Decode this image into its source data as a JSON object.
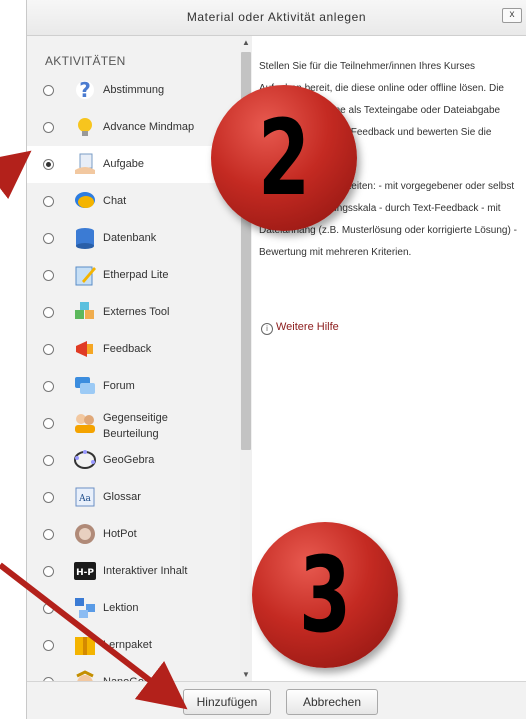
{
  "dialog": {
    "title": "Material oder Aktivität anlegen",
    "close_label": "x"
  },
  "left": {
    "section_label": "AKTIVITÄTEN",
    "selected": "Aufgabe",
    "items": [
      {
        "label": "Abstimmung",
        "icon": "question-icon"
      },
      {
        "label": "Advance Mindmap",
        "icon": "lightbulb-icon"
      },
      {
        "label": "Aufgabe",
        "icon": "hand-document-icon"
      },
      {
        "label": "Chat",
        "icon": "chat-bubble-icon"
      },
      {
        "label": "Datenbank",
        "icon": "database-icon"
      },
      {
        "label": "Etherpad Lite",
        "icon": "pen-notepad-icon"
      },
      {
        "label": "Externes Tool",
        "icon": "puzzle-icon"
      },
      {
        "label": "Feedback",
        "icon": "megaphone-icon"
      },
      {
        "label": "Forum",
        "icon": "forum-icon"
      },
      {
        "label": "Gegenseitige Beurteilung",
        "icon": "people-icon"
      },
      {
        "label": "GeoGebra",
        "icon": "geogebra-icon"
      },
      {
        "label": "Glossar",
        "icon": "glossary-icon"
      },
      {
        "label": "HotPot",
        "icon": "hotpot-icon"
      },
      {
        "label": "Interaktiver Inhalt",
        "icon": "h5p-icon"
      },
      {
        "label": "Lektion",
        "icon": "lesson-icon"
      },
      {
        "label": "Lernpaket",
        "icon": "package-icon"
      },
      {
        "label": "NanoGong",
        "icon": "nanogong-icon"
      }
    ]
  },
  "right": {
    "description_1": "Stellen Sie für die Teilnehmer/innen Ihres Kurses Aufgaben bereit, die diese online oder offline lösen. Die Lösung kann online als Texteingabe oder Dateiabgabe erfolgen. Geben Sie Feedback und bewerten Sie die Lösungen.",
    "description_2": "Bewertungsmöglichkeiten: - mit vorgegebener oder selbst erstellter Bewertungsskala - durch Text-Feedback - mit Dateianhang (z.B. Musterlösung oder korrigierte Lösung) - Bewertung mit mehreren Kriterien.",
    "help_link": "Weitere Hilfe"
  },
  "footer": {
    "add_label": "Hinzufügen",
    "cancel_label": "Abbrechen"
  },
  "annotations": {
    "step_2": "2",
    "step_3": "3",
    "color": "#c42a22"
  }
}
